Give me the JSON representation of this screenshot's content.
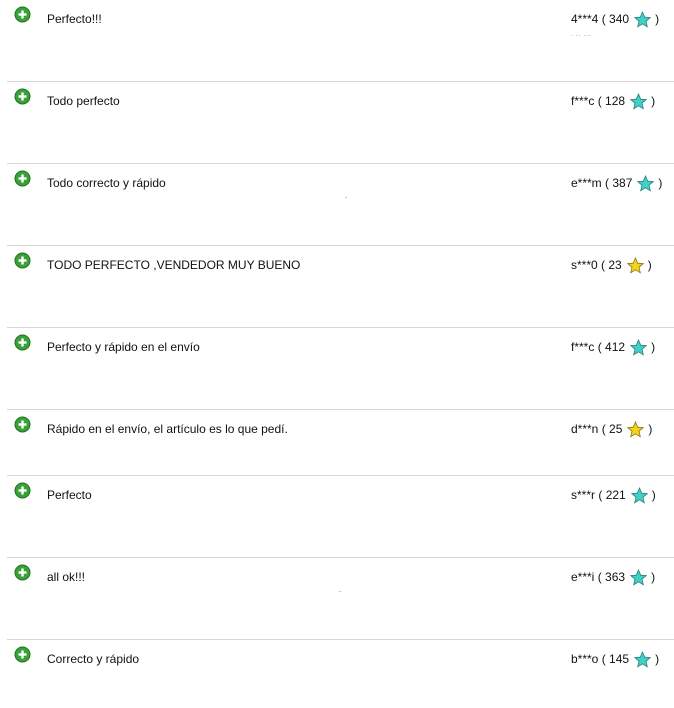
{
  "feedback": [
    {
      "comment": "Perfecto!!!",
      "buyer": "4***4",
      "score": "340",
      "star": "turquoise"
    },
    {
      "comment": "Todo perfecto",
      "buyer": "f***c",
      "score": "128",
      "star": "turquoise"
    },
    {
      "comment": "Todo correcto y rápido",
      "buyer": "e***m",
      "score": "387",
      "star": "turquoise"
    },
    {
      "comment": "TODO PERFECTO ,VENDEDOR MUY BUENO",
      "buyer": "s***0",
      "score": "23",
      "star": "yellow"
    },
    {
      "comment": "Perfecto y rápido en el envío",
      "buyer": "f***c",
      "score": "412",
      "star": "turquoise"
    },
    {
      "comment": "Rápido en el envío, el artículo es lo que pedí.",
      "buyer": "d***n",
      "score": "25",
      "star": "yellow"
    },
    {
      "comment": "Perfecto",
      "buyer": "s***r",
      "score": "221",
      "star": "turquoise"
    },
    {
      "comment": "all ok!!!",
      "buyer": "e***i",
      "score": "363",
      "star": "turquoise"
    },
    {
      "comment": "Correcto y rápido",
      "buyer": "b***o",
      "score": "145",
      "star": "turquoise"
    }
  ],
  "labels": {
    "open_paren": "(",
    "close_paren": ")"
  },
  "icons": {
    "positive": "plus-circle-icon",
    "star": "star-icon"
  },
  "colors": {
    "positive_green": "#3aa13a",
    "star_turquoise": "#40d0c8",
    "star_yellow": "#f4d31c",
    "separator": "#d6d6d6"
  }
}
